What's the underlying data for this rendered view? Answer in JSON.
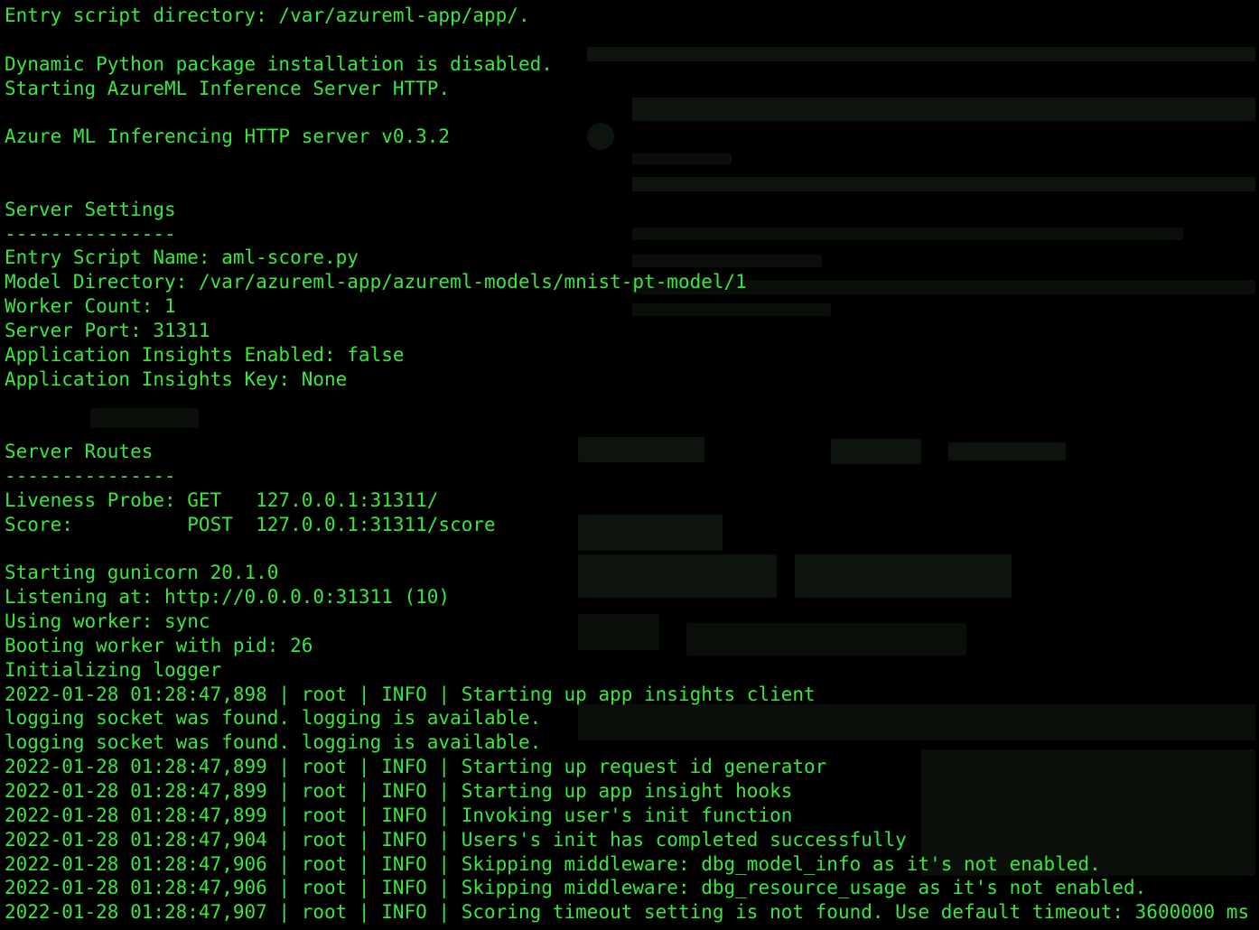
{
  "terminal": {
    "text_color": "#39e83c",
    "background": "#000000",
    "lines": [
      "Entry script directory: /var/azureml-app/app/.",
      "",
      "Dynamic Python package installation is disabled.",
      "Starting AzureML Inference Server HTTP.",
      "",
      "Azure ML Inferencing HTTP server v0.3.2",
      "",
      "",
      "Server Settings",
      "---------------",
      "Entry Script Name: aml-score.py",
      "Model Directory: /var/azureml-app/azureml-models/mnist-pt-model/1",
      "Worker Count: 1",
      "Server Port: 31311",
      "Application Insights Enabled: false",
      "Application Insights Key: None",
      "",
      "",
      "Server Routes",
      "---------------",
      "Liveness Probe: GET   127.0.0.1:31311/",
      "Score:          POST  127.0.0.1:31311/score",
      "",
      "Starting gunicorn 20.1.0",
      "Listening at: http://0.0.0.0:31311 (10)",
      "Using worker: sync",
      "Booting worker with pid: 26",
      "Initializing logger",
      "2022-01-28 01:28:47,898 | root | INFO | Starting up app insights client",
      "logging socket was found. logging is available.",
      "logging socket was found. logging is available.",
      "2022-01-28 01:28:47,899 | root | INFO | Starting up request id generator",
      "2022-01-28 01:28:47,899 | root | INFO | Starting up app insight hooks",
      "2022-01-28 01:28:47,899 | root | INFO | Invoking user's init function",
      "2022-01-28 01:28:47,904 | root | INFO | Users's init has completed successfully",
      "2022-01-28 01:28:47,906 | root | INFO | Skipping middleware: dbg_model_info as it's not enabled.",
      "2022-01-28 01:28:47,906 | root | INFO | Skipping middleware: dbg_resource_usage as it's not enabled.",
      "2022-01-28 01:28:47,907 | root | INFO | Scoring timeout setting is not found. Use default timeout: 3600000 ms"
    ]
  }
}
